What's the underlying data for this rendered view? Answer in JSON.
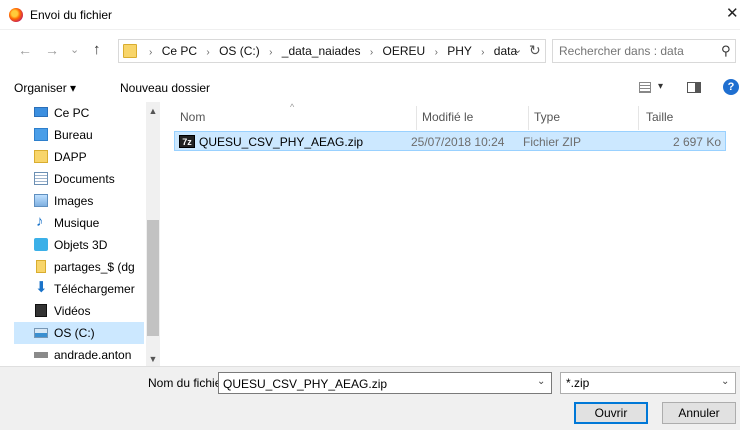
{
  "window": {
    "title": "Envoi du fichier",
    "close_glyph": "✕"
  },
  "nav": {
    "back_glyph": "←",
    "forward_glyph": "→",
    "recent_glyph": "⌄",
    "up_glyph": "↑",
    "breadcrumb": [
      "Ce PC",
      "OS (C:)",
      "_data_naiades",
      "OEREU",
      "PHY",
      "data"
    ],
    "breadcrumb_sep": "›",
    "dropdown_glyph": "⌄",
    "refresh_glyph": "↻",
    "search_placeholder": "Rechercher dans : data",
    "search_glyph": "⚲"
  },
  "toolbar": {
    "organize_label": "Organiser ▾",
    "new_folder_label": "Nouveau dossier",
    "view_dropdown_glyph": "▾",
    "help_glyph": "?"
  },
  "sidebar": {
    "items": [
      {
        "label": "Ce PC",
        "icon": "computer-icon"
      },
      {
        "label": "Bureau",
        "icon": "desktop-folder-icon"
      },
      {
        "label": "DAPP",
        "icon": "folder-icon"
      },
      {
        "label": "Documents",
        "icon": "documents-icon"
      },
      {
        "label": "Images",
        "icon": "pictures-icon"
      },
      {
        "label": "Musique",
        "icon": "music-icon"
      },
      {
        "label": "Objets 3D",
        "icon": "3d-objects-icon"
      },
      {
        "label": "partages_$ (dg",
        "icon": "network-share-icon"
      },
      {
        "label": "Téléchargemer",
        "icon": "downloads-icon"
      },
      {
        "label": "Vidéos",
        "icon": "videos-icon"
      },
      {
        "label": "OS (C:)",
        "icon": "drive-icon"
      },
      {
        "label": "andrade.anton",
        "icon": "network-drive-icon"
      }
    ],
    "music_glyph": "♪",
    "download_glyph": "⬇",
    "scroll_up_glyph": "▲",
    "scroll_down_glyph": "▼"
  },
  "file_list": {
    "columns": [
      "Nom",
      "Modifié le",
      "Type",
      "Taille"
    ],
    "sort_indicator": "^",
    "rows": [
      {
        "icon_text": "7z",
        "name": "QUESU_CSV_PHY_AEAG.zip",
        "modified": "25/07/2018 10:24",
        "type": "Fichier ZIP",
        "size": "2 697 Ko"
      }
    ]
  },
  "footer": {
    "filename_label": "Nom du fichier :",
    "filename_value": "QUESU_CSV_PHY_AEAG.zip",
    "dropdown_glyph": "⌄",
    "filter_value": "*.zip",
    "open_label": "Ouvrir",
    "cancel_label": "Annuler"
  },
  "colors": {
    "selection_bg": "#cce8ff",
    "selection_border": "#99d1ff",
    "accent": "#0078d7"
  }
}
